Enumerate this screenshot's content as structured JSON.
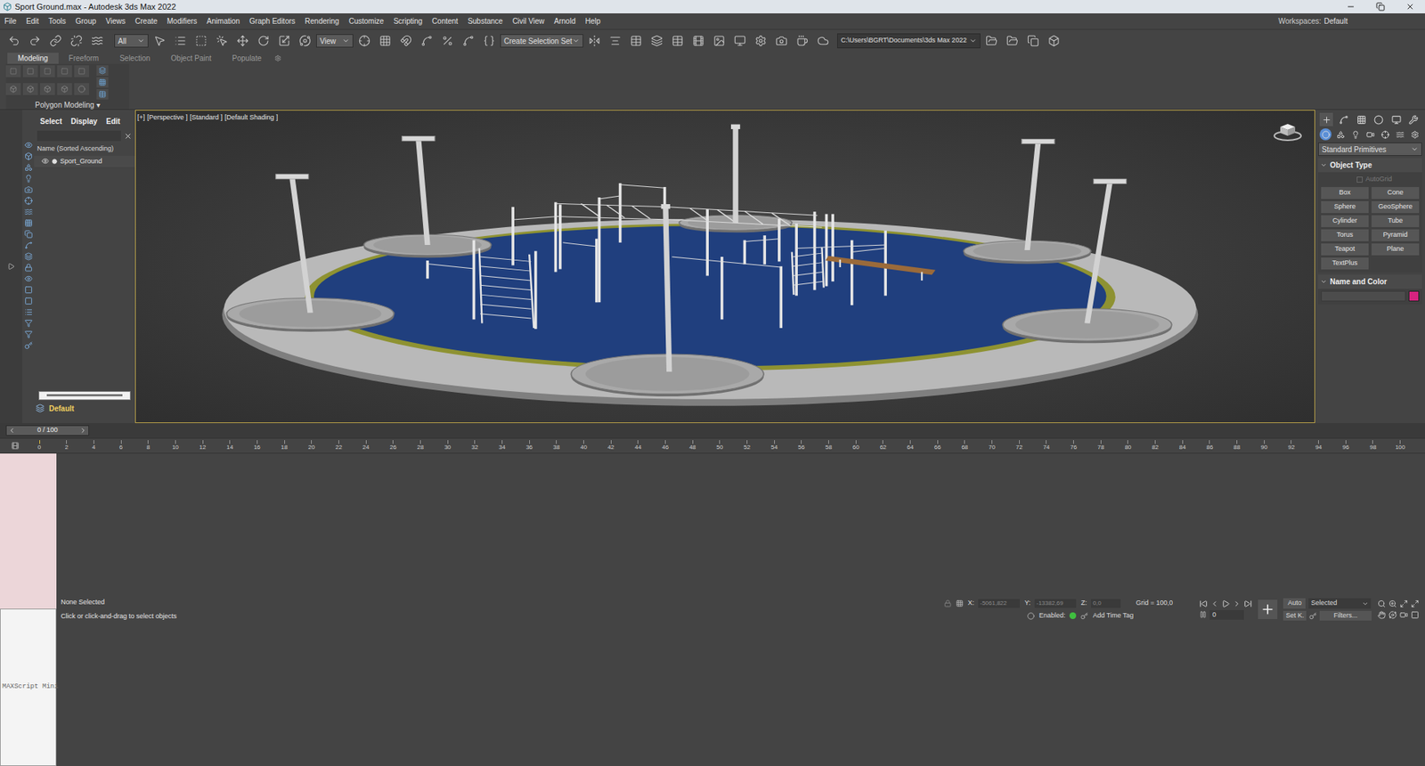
{
  "window": {
    "title": "Sport Ground.max - Autodesk 3ds Max 2022",
    "workspaces_label": "Workspaces:",
    "workspace": "Default"
  },
  "menu": [
    "File",
    "Edit",
    "Tools",
    "Group",
    "Views",
    "Create",
    "Modifiers",
    "Animation",
    "Graph Editors",
    "Rendering",
    "Customize",
    "Scripting",
    "Content",
    "Substance",
    "Civil View",
    "Arnold",
    "Help"
  ],
  "toolbar": {
    "selection_filter": "All",
    "reference_coord": "View",
    "selection_set": "Create Selection Set",
    "project_path": "C:\\Users\\BGRT\\Documents\\3ds Max 2022"
  },
  "ribbon": {
    "tabs": [
      {
        "label": "Modeling",
        "selected": true
      },
      {
        "label": "Freeform",
        "selected": false
      },
      {
        "label": "Selection",
        "selected": false
      },
      {
        "label": "Object Paint",
        "selected": false
      },
      {
        "label": "Populate",
        "selected": false
      }
    ],
    "panel_label": "Polygon Modeling ▾"
  },
  "scene_explorer": {
    "tabs": [
      "Select",
      "Display",
      "Edit"
    ],
    "column": "Name (Sorted Ascending)",
    "items": [
      {
        "name": "Sport_Ground",
        "visible": true,
        "selected": false
      }
    ],
    "layer": "Default"
  },
  "viewport": {
    "labels": [
      "[+]",
      "[Perspective ]",
      "[Standard ]",
      "[Default Shading ]"
    ],
    "active": true
  },
  "command_panel": {
    "category": "Standard Primitives",
    "object_type": "Object Type",
    "autogrid": {
      "label": "AutoGrid",
      "checked": false,
      "disabled": true
    },
    "buttons": [
      "Box",
      "Cone",
      "Sphere",
      "GeoSphere",
      "Cylinder",
      "Tube",
      "Torus",
      "Pyramid",
      "Teapot",
      "Plane",
      "TextPlus"
    ],
    "name_and_color": "Name and Color",
    "object_color": "#d6237f"
  },
  "timeline": {
    "frame": "0 / 100",
    "level": 0.0,
    "ticks": [
      "0",
      "2",
      "4",
      "6",
      "8",
      "10",
      "12",
      "14",
      "16",
      "18",
      "20",
      "22",
      "24",
      "26",
      "28",
      "30",
      "32",
      "34",
      "36",
      "38",
      "40",
      "42",
      "44",
      "46",
      "48",
      "50",
      "52",
      "54",
      "56",
      "58",
      "60",
      "62",
      "64",
      "66",
      "68",
      "70",
      "72",
      "74",
      "76",
      "78",
      "80",
      "82",
      "84",
      "86",
      "88",
      "90",
      "92",
      "94",
      "96",
      "98",
      "100"
    ]
  },
  "status": {
    "maxscript": "MAXScript Mini",
    "selection": "None Selected",
    "prompt": "Click or click-and-drag to select objects",
    "x_label": "X:",
    "x_value": "-5061,822",
    "y_label": "Y:",
    "y_value": "-13382,69",
    "z_label": "Z:",
    "z_value": "0,0",
    "grid": "Grid = 100,0",
    "enabled_label": "Enabled:",
    "add_time_tag": "Add Time Tag",
    "auto_key": "Auto",
    "key_filter": "Selected",
    "set_key": "Set K.",
    "filters": "Filters...",
    "current_frame": "0"
  }
}
